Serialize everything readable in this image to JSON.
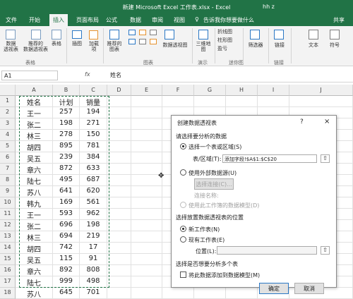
{
  "app": {
    "title": "新建 Microsoft Excel 工作表.xlsx - Excel",
    "user": "hh z"
  },
  "tabs": [
    "文件",
    "开始",
    "插入",
    "页面布局",
    "公式",
    "数据",
    "审阅",
    "视图"
  ],
  "active_tab": "插入",
  "tell_me": "告诉我你想要做什么",
  "share": "共享",
  "ribbon": {
    "pivot": "数据\n透视表",
    "recommended_pivot": "推荐的\n数据透视表",
    "table": "表格",
    "illustrations": "插图",
    "addins": "加载\n项",
    "recommended_charts": "推荐的\n图表",
    "pivot_chart": "数据透视图",
    "map3d": "三维地\n图",
    "sparkline_line": "折线图",
    "sparkline_column": "柱形图",
    "sparkline_winloss": "盈亏",
    "slicer": "筛选器",
    "link": "链接",
    "text": "文本",
    "symbol": "符号",
    "group_tables": "表格",
    "group_charts": "图表",
    "group_tours": "演示",
    "group_sparklines": "迷你图",
    "group_links": "链接",
    "icon_colors": {
      "blue": "#2b78c5",
      "orange": "#e6922e",
      "gray": "#7f7f7f"
    }
  },
  "formula": {
    "namebox": "A1",
    "fx": "fx",
    "value": "姓名"
  },
  "columns": [
    "A",
    "B",
    "C",
    "D",
    "E",
    "F",
    "G",
    "H",
    "I",
    "J"
  ],
  "rows": [
    [
      "姓名",
      "计划",
      "销量"
    ],
    [
      "王一",
      "257",
      "194"
    ],
    [
      "张二",
      "198",
      "271"
    ],
    [
      "林三",
      "278",
      "150"
    ],
    [
      "胡四",
      "895",
      "781"
    ],
    [
      "吴五",
      "239",
      "384"
    ],
    [
      "章六",
      "872",
      "633"
    ],
    [
      "陆七",
      "495",
      "687"
    ],
    [
      "苏八",
      "641",
      "620"
    ],
    [
      "韩九",
      "169",
      "561"
    ],
    [
      "王一",
      "593",
      "962"
    ],
    [
      "张二",
      "696",
      "198"
    ],
    [
      "林三",
      "694",
      "219"
    ],
    [
      "胡四",
      "742",
      "17"
    ],
    [
      "吴五",
      "115",
      "91"
    ],
    [
      "章六",
      "892",
      "808"
    ],
    [
      "陆七",
      "999",
      "498"
    ],
    [
      "苏八",
      "645",
      "701"
    ]
  ],
  "dialog": {
    "title": "创建数据透视表",
    "help": "?",
    "close": "×",
    "section1": "请选择要分析的数据",
    "opt_range": "选择一个表或区域(S)",
    "range_label": "表/区域(T):",
    "range_value": "添加字段!$A$1:$C$20",
    "opt_external": "使用外部数据源(U)",
    "choose_conn": "选择连接(C)...",
    "conn_name": "连接名称:",
    "use_model": "使用此工作簿的数据模型(D)",
    "section2": "选择放置数据透视表的位置",
    "opt_new": "新工作表(N)",
    "opt_existing": "现有工作表(E)",
    "location_label": "位置(L):",
    "location_value": "",
    "section3": "选择是否想要分析多个表",
    "add_model": "将此数据添加到数据模型(M)",
    "ok": "确定",
    "cancel": "取消"
  }
}
